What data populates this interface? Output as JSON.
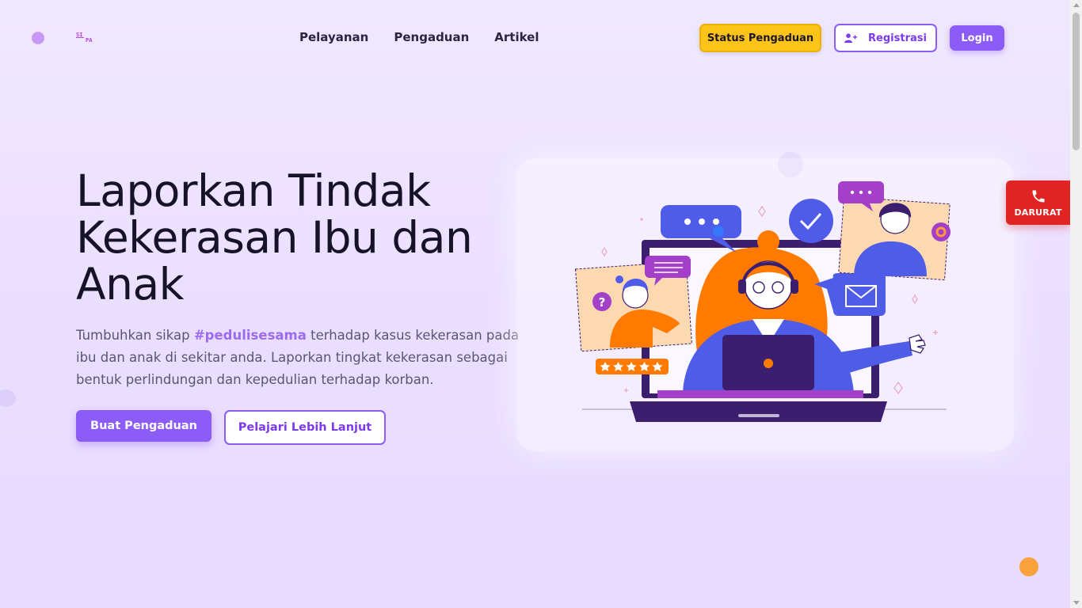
{
  "brand": {
    "logo_top": "SI",
    "logo_bottom": "PA"
  },
  "nav": {
    "menu": [
      "Pelayanan",
      "Pengaduan",
      "Artikel"
    ],
    "status_button": "Status Pengaduan",
    "register_button": "Registrasi",
    "login_button": "Login"
  },
  "hero": {
    "title": "Laporkan Tindak Kekerasan Ibu dan Anak",
    "desc_before": "Tumbuhkan sikap ",
    "desc_tag": "#pedulisesama",
    "desc_after": " terhadap kasus kekerasan pada ibu dan anak di sekitar anda. Laporkan tingkat kekerasan sebagai bentuk perlindungan dan kepedulian terhadap korban.",
    "primary_button": "Buat Pengaduan",
    "secondary_button": "Pelajari Lebih Lanjut"
  },
  "emergency": {
    "label": "DARURAT",
    "icon": "phone-icon"
  },
  "illustration": {
    "rating_stars": 5
  },
  "colors": {
    "accent": "#8b5cf6",
    "status": "#fcc419",
    "emergency": "#e02424",
    "orange": "#ff7a00"
  }
}
